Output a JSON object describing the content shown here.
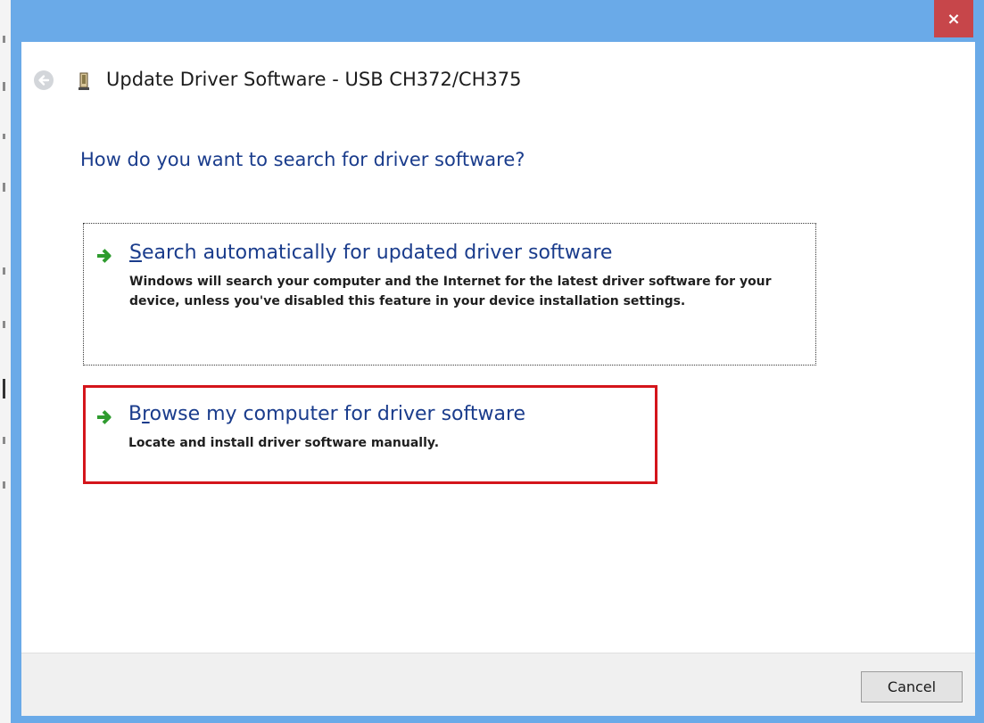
{
  "window": {
    "close_label": "×",
    "title": "Update Driver Software - USB CH372/CH375"
  },
  "question": "How do you want to search for driver software?",
  "options": [
    {
      "title_prefix": "",
      "title_accel": "S",
      "title_rest": "earch automatically for updated driver software",
      "description": "Windows will search your computer and the Internet for the latest driver software for your device, unless you've disabled this feature in your device installation settings."
    },
    {
      "title_prefix": "B",
      "title_accel": "r",
      "title_rest": "owse my computer for driver software",
      "description": "Locate and install driver software manually."
    }
  ],
  "footer": {
    "cancel_label": "Cancel"
  },
  "colors": {
    "titlebar": "#6aaae8",
    "close": "#c7464a",
    "link_blue": "#1a3c8c",
    "highlight_red": "#d4151b",
    "arrow_green": "#2e9b2e"
  },
  "icons": {
    "back": "back-arrow-icon",
    "device": "usb-device-icon",
    "option_arrow": "green-arrow-icon"
  }
}
